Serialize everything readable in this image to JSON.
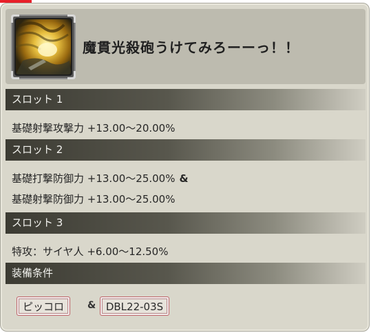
{
  "item": {
    "name": "魔貫光殺砲うけてみろーーっ！！",
    "icon": "item-thumbnail-icon"
  },
  "sections": [
    {
      "title": "スロット 1",
      "lines": [
        "基礎射撃攻撃力 +13.00〜20.00%"
      ]
    },
    {
      "title": "スロット 2",
      "lines": [
        "基礎打撃防御力 +13.00〜25.00%",
        "基礎射撃防御力 +13.00〜25.00%"
      ],
      "joiner": "&"
    },
    {
      "title": "スロット 3",
      "lines": [
        "特攻：サイヤ人 +6.00〜12.50%"
      ]
    }
  ],
  "conditions": {
    "title": "装備条件",
    "items": [
      "ピッコロ",
      "DBL22-03S"
    ],
    "joiner": "&"
  },
  "colors": {
    "panel": "#d9d7cb",
    "header": "#bdbbaf",
    "section_bar_dark": "#3c3b33",
    "badge_border": "#c0666b"
  }
}
